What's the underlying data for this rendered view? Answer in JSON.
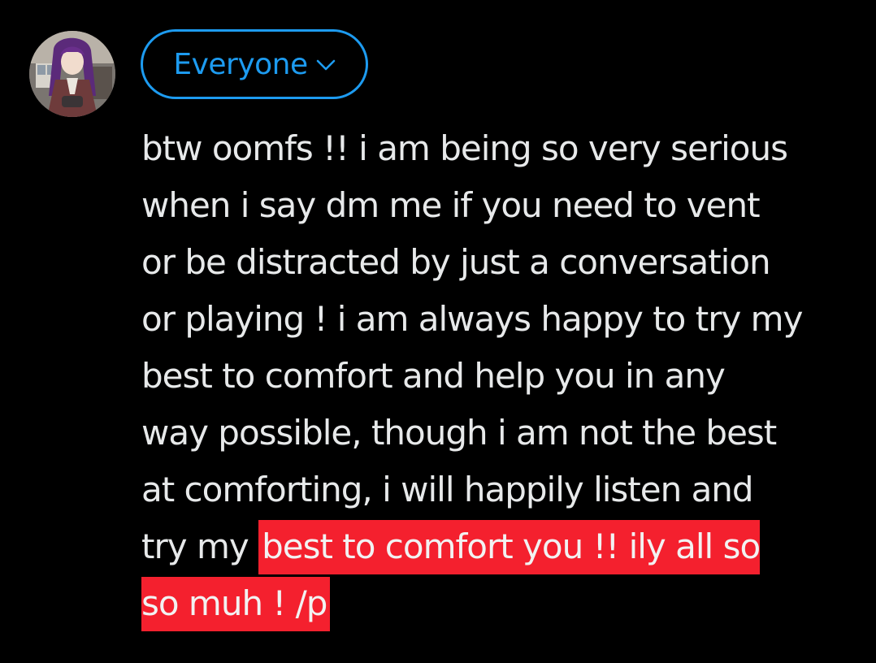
{
  "composer": {
    "avatar": {
      "description_icon": "profile-avatar",
      "alt": ""
    },
    "audience": {
      "label": "Everyone",
      "icon": "chevron-down-icon",
      "accent_color": "#1d9bf0"
    },
    "post": {
      "text_before_selection": "btw oomfs !! i am being so very serious\nwhen i say dm me if you need to vent\nor be distracted by just a conversation\nor playing ! i am always happy to try my\nbest to comfort and help you in any\nway possible, though i am not the best\nat comforting, i will happily listen and\ntry my ",
      "selected_text": "best to comfort you !! ily all so\nso muh ! /p",
      "selection_color": "#f4202e",
      "text_color": "#e7e9ea"
    }
  }
}
